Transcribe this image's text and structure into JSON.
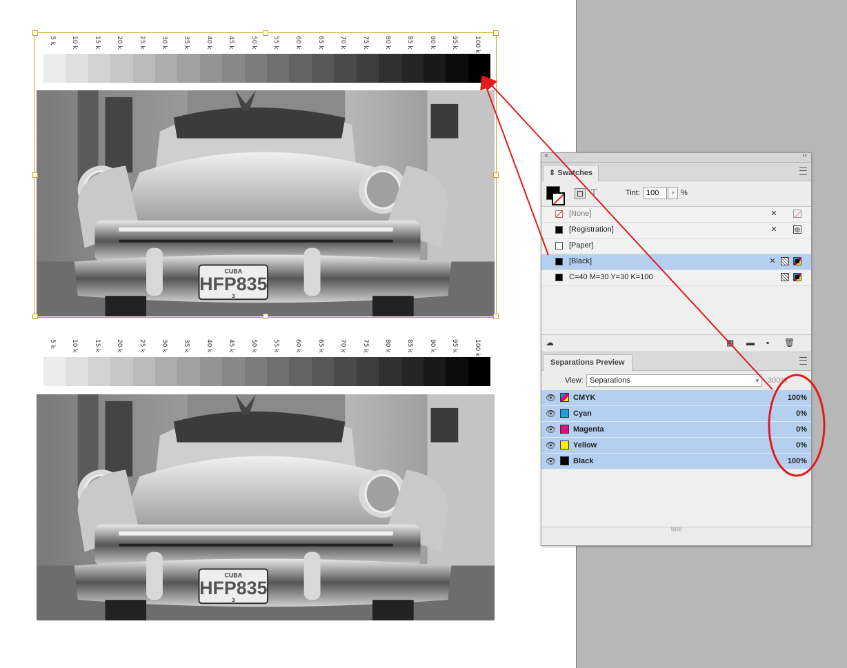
{
  "ramp": {
    "labels": [
      "5 k",
      "10 k",
      "15 k",
      "20 k",
      "25 k",
      "30 k",
      "35 k",
      "40 k",
      "45 k",
      "50 k",
      "55 k",
      "60 k",
      "65 k",
      "70 k",
      "75 k",
      "80 k",
      "85 k",
      "90 k",
      "95 k",
      "100 k"
    ],
    "tints_percent": [
      5,
      10,
      15,
      20,
      25,
      30,
      35,
      40,
      45,
      50,
      55,
      60,
      65,
      70,
      75,
      80,
      85,
      90,
      95,
      100
    ]
  },
  "photo": {
    "plate_top": "CUBA",
    "plate_number": "HFP835",
    "plate_bottom": "3"
  },
  "swatches_panel": {
    "close": "×",
    "collapse": "‹‹",
    "tab": "Swatches",
    "tint_label": "Tint:",
    "tint_value": "100",
    "tint_unit": "%",
    "items": [
      {
        "name": "[None]",
        "color": "none"
      },
      {
        "name": "[Registration]",
        "color": "#000000"
      },
      {
        "name": "[Paper]",
        "color": "#ffffff"
      },
      {
        "name": "[Black]",
        "color": "#000000",
        "selected": true
      },
      {
        "name": "C=40 M=30 Y=30 K=100",
        "color": "#000000"
      }
    ]
  },
  "separations_panel": {
    "tab": "Separations Preview",
    "view_label": "View:",
    "view_value": "Separations",
    "zoom": "300%",
    "plates": [
      {
        "name": "CMYK",
        "value": "100%",
        "color": "cmyk"
      },
      {
        "name": "Cyan",
        "value": "0%",
        "color": "#1aa3e0"
      },
      {
        "name": "Magenta",
        "value": "0%",
        "color": "#e0127e"
      },
      {
        "name": "Yellow",
        "value": "0%",
        "color": "#ffee00"
      },
      {
        "name": "Black",
        "value": "100%",
        "color": "#000000"
      }
    ]
  },
  "annotation_color": "#e21b1b"
}
